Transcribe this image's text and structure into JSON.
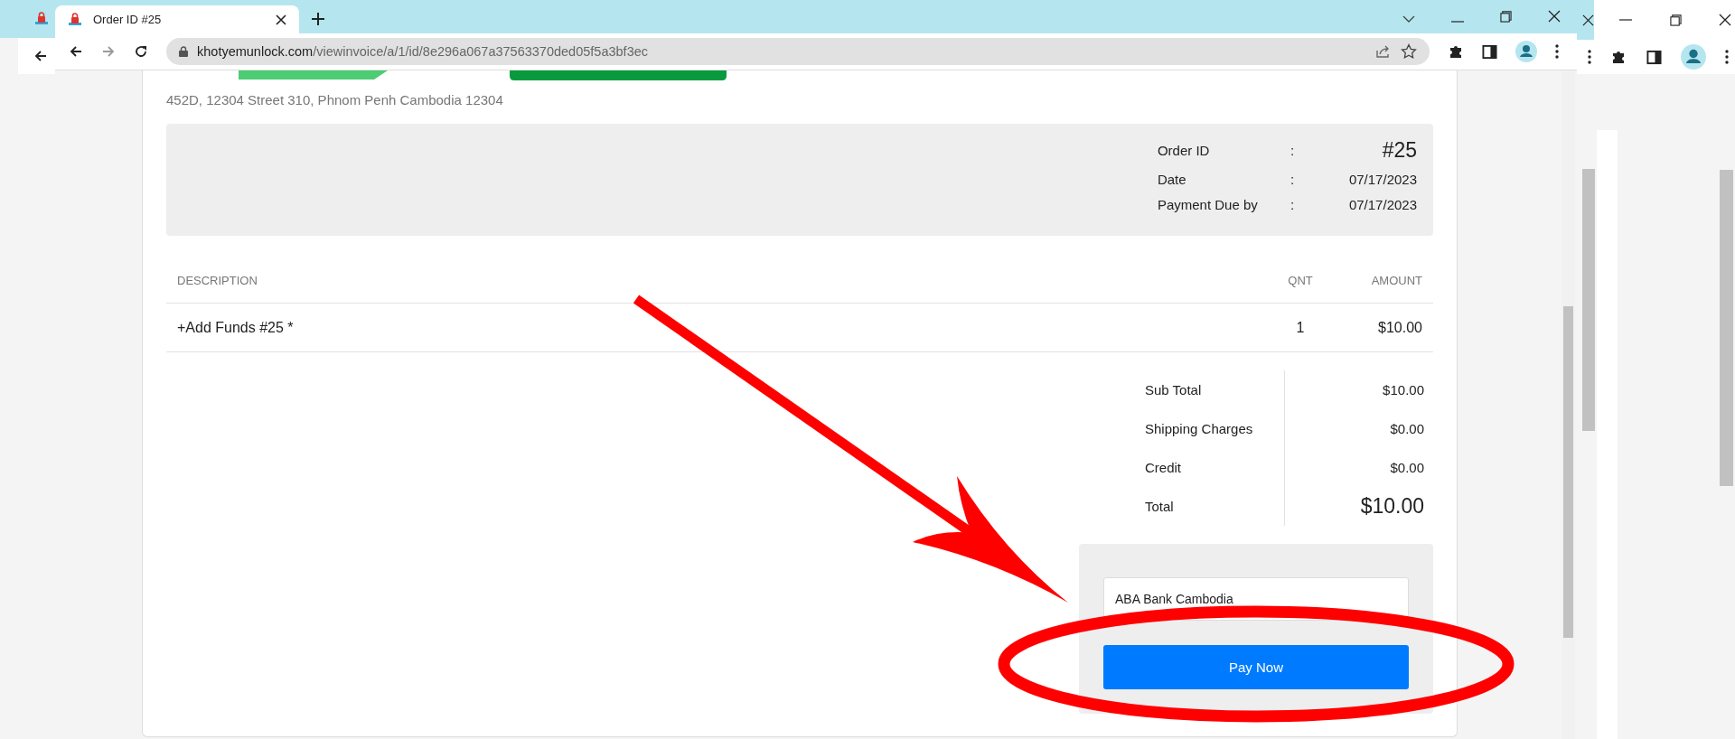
{
  "browser": {
    "tabs": [
      {
        "title": "Order ID #25",
        "selected": true
      }
    ],
    "url": {
      "domain": "khotyemunlock.com",
      "path": "/viewinvoice/a/1/id/8e296a067a37563370ded05f5a3bf3ec"
    }
  },
  "invoice": {
    "address": "452D, 12304 Street 310, Phnom Penh Cambodia 12304",
    "meta": [
      {
        "label": "Order ID",
        "separator": ":",
        "value": "#25",
        "kind": "large"
      },
      {
        "label": "Date",
        "separator": ":",
        "value": "07/17/2023",
        "kind": "normal"
      },
      {
        "label": "Payment Due by",
        "separator": ":",
        "value": "07/17/2023",
        "kind": "normal"
      }
    ],
    "columns": [
      "DESCRIPTION",
      "QNT",
      "AMOUNT"
    ],
    "items": [
      {
        "description": "+Add Funds #25 *",
        "qty": "1",
        "amount": "$10.00"
      }
    ],
    "totals": [
      {
        "label": "Sub Total",
        "value": "$10.00",
        "kind": "normal"
      },
      {
        "label": "Shipping Charges",
        "value": "$0.00",
        "kind": "normal"
      },
      {
        "label": "Credit",
        "value": "$0.00",
        "kind": "normal"
      },
      {
        "label": "Total",
        "value": "$10.00",
        "kind": "grand"
      }
    ],
    "payment": {
      "method": "ABA Bank Cambodia",
      "button": "Pay Now"
    }
  }
}
